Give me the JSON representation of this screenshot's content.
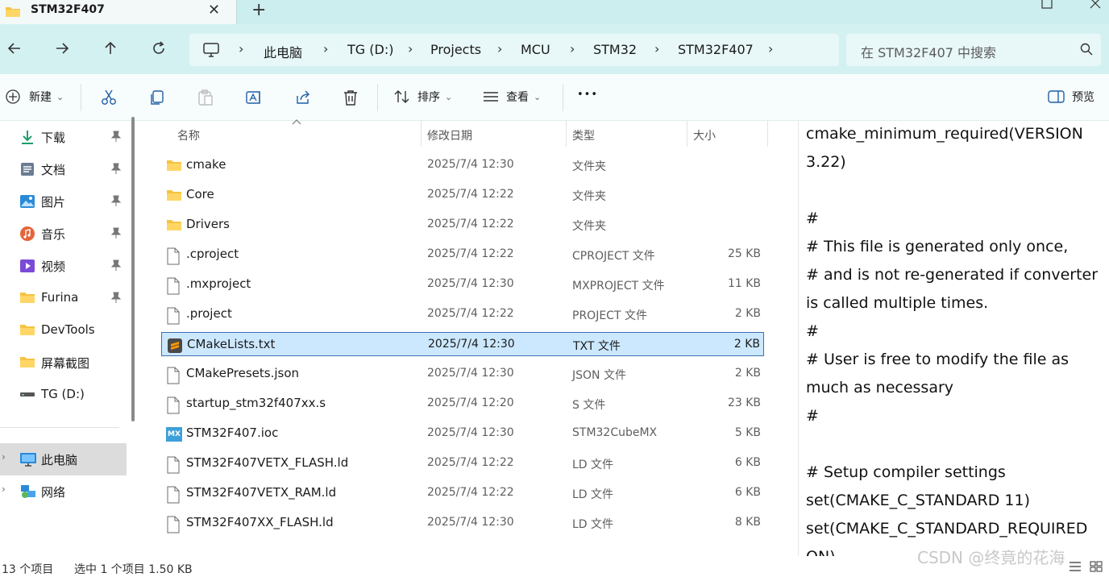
{
  "tab": {
    "title": "STM32F407",
    "close_glyph": "✕",
    "new_glyph": "+"
  },
  "breadcrumb": {
    "items": [
      "此电脑",
      "TG (D:)",
      "Projects",
      "MCU",
      "STM32",
      "STM32F407"
    ],
    "separator": "›"
  },
  "search": {
    "placeholder": "在 STM32F407 中搜索"
  },
  "toolbar": {
    "new_label": "新建",
    "sort_label": "排序",
    "view_label": "查看",
    "more_label": "•••",
    "preview_label": "预览",
    "caret": "⌄"
  },
  "sidebar": {
    "items": [
      {
        "label": "下载",
        "icon": "download-icon",
        "pinned": true
      },
      {
        "label": "文档",
        "icon": "document-icon",
        "pinned": true
      },
      {
        "label": "图片",
        "icon": "pictures-icon",
        "pinned": true
      },
      {
        "label": "音乐",
        "icon": "music-icon",
        "pinned": true
      },
      {
        "label": "视频",
        "icon": "video-icon",
        "pinned": true
      },
      {
        "label": "Furina",
        "icon": "folder-icon",
        "pinned": true
      },
      {
        "label": "DevTools",
        "icon": "folder-icon",
        "pinned": false
      },
      {
        "label": "屏幕截图",
        "icon": "folder-icon",
        "pinned": false
      },
      {
        "label": "TG (D:)",
        "icon": "drive-icon",
        "pinned": false
      }
    ],
    "this_pc": "此电脑",
    "network": "网络",
    "pin_glyph": "📌",
    "expander_glyph": "›"
  },
  "columns": {
    "name": "名称",
    "date": "修改日期",
    "type": "类型",
    "size": "大小"
  },
  "files": [
    {
      "name": "cmake",
      "date": "2025/7/4 12:30",
      "type": "文件夹",
      "size": "",
      "icon": "folder-icon"
    },
    {
      "name": "Core",
      "date": "2025/7/4 12:22",
      "type": "文件夹",
      "size": "",
      "icon": "folder-icon"
    },
    {
      "name": "Drivers",
      "date": "2025/7/4 12:22",
      "type": "文件夹",
      "size": "",
      "icon": "folder-icon"
    },
    {
      "name": ".cproject",
      "date": "2025/7/4 12:22",
      "type": "CPROJECT 文件",
      "size": "25 KB",
      "icon": "file-icon"
    },
    {
      "name": ".mxproject",
      "date": "2025/7/4 12:30",
      "type": "MXPROJECT 文件",
      "size": "11 KB",
      "icon": "file-icon"
    },
    {
      "name": ".project",
      "date": "2025/7/4 12:22",
      "type": "PROJECT 文件",
      "size": "2 KB",
      "icon": "file-icon"
    },
    {
      "name": "CMakeLists.txt",
      "date": "2025/7/4 12:30",
      "type": "TXT 文件",
      "size": "2 KB",
      "icon": "sublime-icon",
      "selected": true
    },
    {
      "name": "CMakePresets.json",
      "date": "2025/7/4 12:30",
      "type": "JSON 文件",
      "size": "2 KB",
      "icon": "file-icon"
    },
    {
      "name": "startup_stm32f407xx.s",
      "date": "2025/7/4 12:20",
      "type": "S 文件",
      "size": "23 KB",
      "icon": "file-icon"
    },
    {
      "name": "STM32F407.ioc",
      "date": "2025/7/4 12:30",
      "type": "STM32CubeMX",
      "size": "5 KB",
      "icon": "mx-icon",
      "icon_text": "MX"
    },
    {
      "name": "STM32F407VETX_FLASH.ld",
      "date": "2025/7/4 12:22",
      "type": "LD 文件",
      "size": "6 KB",
      "icon": "file-icon"
    },
    {
      "name": "STM32F407VETX_RAM.ld",
      "date": "2025/7/4 12:22",
      "type": "LD 文件",
      "size": "6 KB",
      "icon": "file-icon"
    },
    {
      "name": "STM32F407XX_FLASH.ld",
      "date": "2025/7/4 12:30",
      "type": "LD 文件",
      "size": "8 KB",
      "icon": "file-icon"
    }
  ],
  "preview_lines": [
    "cmake_minimum_required(VERSION",
    "3.22)",
    "",
    "#",
    "# This file is generated only once,",
    "# and is not re-generated if converter",
    "is called multiple times.",
    "#",
    "# User is free to modify the file as",
    "much as necessary",
    "#",
    "",
    "# Setup compiler settings",
    "set(CMAKE_C_STANDARD 11)",
    "set(CMAKE_C_STANDARD_REQUIRED",
    "ON)"
  ],
  "status": {
    "count": "13 个项目",
    "selection": "选中 1 个项目  1.50 KB"
  },
  "watermark": "CSDN @终竟的花海",
  "colors": {
    "accent": "#0067c0",
    "tabbar": "#cdeeee",
    "selection": "#cce8ff",
    "folder": "#f5c342"
  }
}
